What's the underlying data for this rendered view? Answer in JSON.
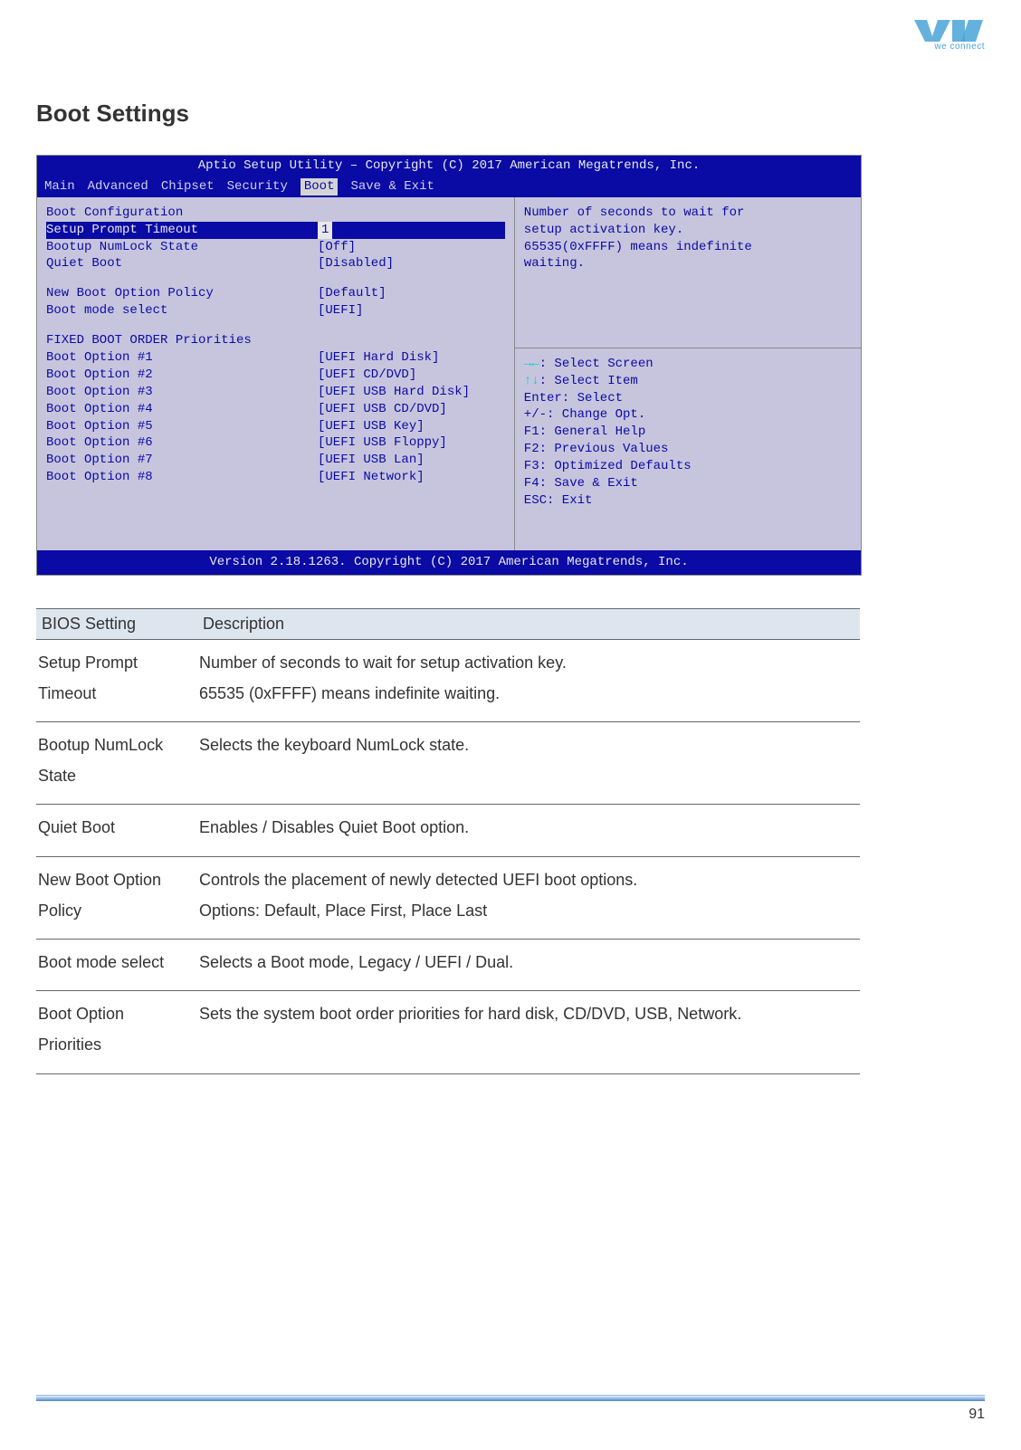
{
  "logo": {
    "tagline": "we connect"
  },
  "section_title": "Boot Settings",
  "bios": {
    "title": "Aptio Setup Utility – Copyright (C) 2017 American Megatrends, Inc.",
    "menu": [
      "Main",
      "Advanced",
      "Chipset",
      "Security",
      "Boot",
      "Save & Exit"
    ],
    "active_menu": "Boot",
    "group1_heading": "Boot Configuration",
    "items1": [
      {
        "label": "Setup Prompt Timeout",
        "value": "1",
        "selected": true
      },
      {
        "label": "Bootup NumLock State",
        "value": "[Off]"
      },
      {
        "label": "Quiet Boot",
        "value": "[Disabled]"
      }
    ],
    "items2": [
      {
        "label": "New Boot Option Policy",
        "value": "[Default]"
      },
      {
        "label": "Boot mode select",
        "value": "[UEFI]"
      }
    ],
    "group2_heading": "FIXED BOOT ORDER Priorities",
    "boot_order": [
      {
        "label": "Boot Option #1",
        "value": "[UEFI Hard Disk]"
      },
      {
        "label": "Boot Option #2",
        "value": "[UEFI CD/DVD]"
      },
      {
        "label": "Boot Option #3",
        "value": "[UEFI USB Hard Disk]"
      },
      {
        "label": "Boot Option #4",
        "value": "[UEFI USB CD/DVD]"
      },
      {
        "label": "Boot Option #5",
        "value": "[UEFI USB Key]"
      },
      {
        "label": "Boot Option #6",
        "value": "[UEFI USB Floppy]"
      },
      {
        "label": "Boot Option #7",
        "value": "[UEFI USB Lan]"
      },
      {
        "label": "Boot Option #8",
        "value": "[UEFI Network]"
      }
    ],
    "help": [
      "Number of seconds to wait for",
      "setup activation key.",
      "65535(0xFFFF) means indefinite",
      "waiting."
    ],
    "keys": [
      "→←: Select Screen",
      "↑↓: Select Item",
      "Enter: Select",
      "+/-: Change Opt.",
      "F1: General Help",
      "F2: Previous Values",
      "F3: Optimized Defaults",
      "F4: Save & Exit",
      "ESC: Exit"
    ],
    "footer": "Version 2.18.1263. Copyright (C) 2017 American Megatrends, Inc."
  },
  "table": {
    "headers": [
      "BIOS Setting",
      "Description"
    ],
    "rows": [
      {
        "setting": "Setup Prompt Timeout",
        "desc": "Number of seconds to wait for setup activation key.\n65535 (0xFFFF) means indefinite waiting."
      },
      {
        "setting": "Bootup NumLock State",
        "desc": "Selects the keyboard NumLock state."
      },
      {
        "setting": "Quiet Boot",
        "desc": "Enables / Disables Quiet Boot option."
      },
      {
        "setting": "New Boot Option Policy",
        "desc": "Controls the placement of newly detected UEFI boot options.\nOptions: Default, Place First, Place Last"
      },
      {
        "setting": "Boot mode select",
        "desc": "Selects a Boot mode, Legacy / UEFI / Dual."
      },
      {
        "setting": "Boot Option Priorities",
        "desc": "Sets the system boot order priorities for hard disk, CD/DVD, USB, Network."
      }
    ]
  },
  "page_number": "91"
}
